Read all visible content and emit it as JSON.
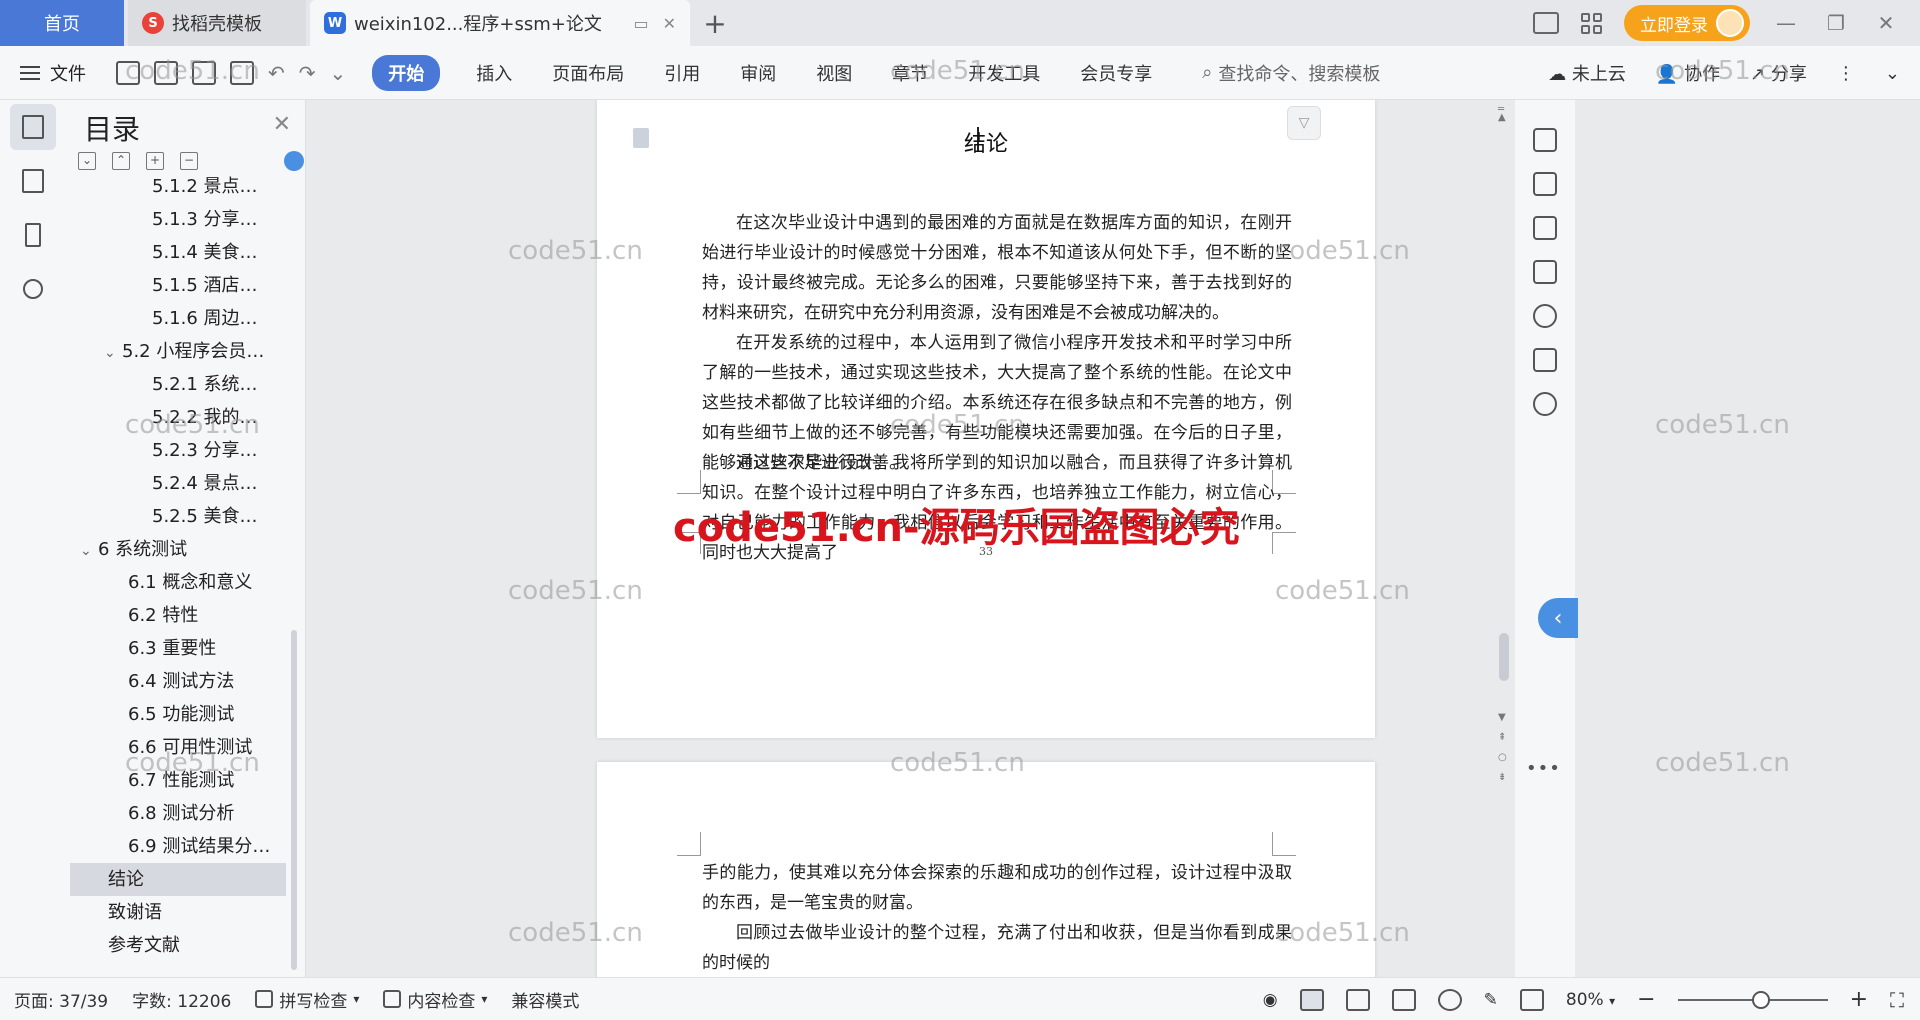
{
  "titlebar": {
    "tabs": [
      {
        "label": "首页"
      },
      {
        "label": "找稻壳模板"
      },
      {
        "label": "weixin102...程序+ssm+论文"
      }
    ],
    "login_label": "立即登录"
  },
  "ribbon": {
    "file_label": "文件",
    "tabs": [
      "开始",
      "插入",
      "页面布局",
      "引用",
      "审阅",
      "视图",
      "章节",
      "开发工具",
      "会员专享"
    ],
    "search_placeholder": "查找命令、搜索模板",
    "cloud_label": "未上云",
    "collab_label": "协作",
    "share_label": "分享"
  },
  "toc": {
    "title": "目录",
    "items": [
      {
        "label": "5.1.2 景点…",
        "level": "l3"
      },
      {
        "label": "5.1.3 分享…",
        "level": "l3"
      },
      {
        "label": "5.1.4 美食…",
        "level": "l3"
      },
      {
        "label": "5.1.5 酒店…",
        "level": "l3"
      },
      {
        "label": "5.1.6 周边…",
        "level": "l3"
      },
      {
        "label": "5.2 小程序会员…",
        "level": "l2c"
      },
      {
        "label": "5.2.1 系统…",
        "level": "l3"
      },
      {
        "label": "5.2.2 我的…",
        "level": "l3"
      },
      {
        "label": "5.2.3 分享…",
        "level": "l3"
      },
      {
        "label": "5.2.4 景点…",
        "level": "l3"
      },
      {
        "label": "5.2.5 美食…",
        "level": "l3"
      },
      {
        "label": "6 系统测试",
        "level": "l1c"
      },
      {
        "label": "6.1 概念和意义",
        "level": "l2"
      },
      {
        "label": "6.2 特性",
        "level": "l2"
      },
      {
        "label": "6.3 重要性",
        "level": "l2"
      },
      {
        "label": "6.4 测试方法",
        "level": "l2"
      },
      {
        "label": "6.5 功能测试",
        "level": "l2"
      },
      {
        "label": "6.6 可用性测试",
        "level": "l2"
      },
      {
        "label": "6.7 性能测试",
        "level": "l2"
      },
      {
        "label": "6.8 测试分析",
        "level": "l2"
      },
      {
        "label": "6.9 测试结果分…",
        "level": "l2"
      },
      {
        "label": "结论",
        "level": "l1",
        "selected": true
      },
      {
        "label": "致谢语",
        "level": "l1"
      },
      {
        "label": "参考文献",
        "level": "l1"
      }
    ]
  },
  "document": {
    "heading": "结论",
    "page1_paragraphs": [
      "在这次毕业设计中遇到的最困难的方面就是在数据库方面的知识，在刚开始进行毕业设计的时候感觉十分困难，根本不知道该从何处下手，但不断的坚持，设计最终被完成。无论多么的困难，只要能够坚持下来，善于去找到好的材料来研究，在研究中充分利用资源，没有困难是不会被成功解决的。",
      "在开发系统的过程中，本人运用到了微信小程序开发技术和平时学习中所了解的一些技术，通过实现这些技术，大大提高了整个系统的性能。在论文中这些技术都做了比较详细的介绍。本系统还存在很多缺点和不完善的地方，例如有些细节上做的还不够完善，有些功能模块还需要加强。在今后的日子里，能够对这些不足进行改善。",
      "通过这次毕业设计，我将所学到的知识加以融合，而且获得了许多计算机知识。在整个设计过程中明白了许多东西，也培养独立工作能力，树立信心，对自己能力的工作能力，我相信以后会学习和工作生活中有至关重要的作用。同时也大大提高了"
    ],
    "page_number": "33",
    "page2_paragraphs": [
      "手的能力，使其难以充分体会探索的乐趣和成功的创作过程，设计过程中汲取的东西，是一笔宝贵的财富。",
      "回顾过去做毕业设计的整个过程，充满了付出和收获，但是当你看到成果的时候的"
    ]
  },
  "statusbar": {
    "page_info": "页面: 37/39",
    "word_count": "字数: 12206",
    "spell_check": "拼写检查",
    "content_check": "内容检查",
    "compat_mode": "兼容模式",
    "zoom": "80%"
  },
  "watermarks": {
    "text": "code51.cn",
    "red_text": "code51.cn-源码乐园盗图必究"
  },
  "colors": {
    "accent": "#4a78d6",
    "login": "#f6a21a",
    "watermark_red": "#d8141c"
  }
}
